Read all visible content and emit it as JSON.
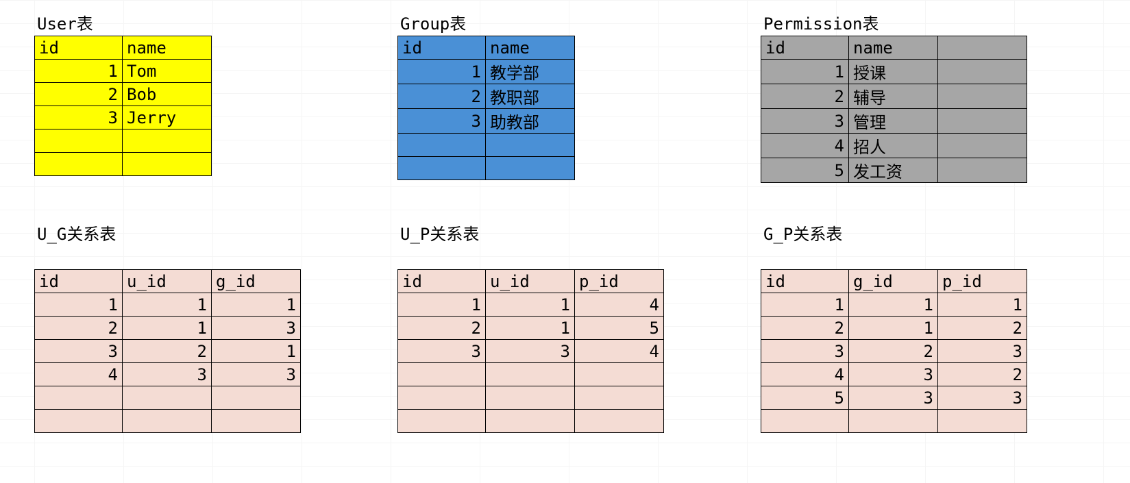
{
  "user": {
    "title": "User表",
    "headers": [
      "id",
      "name"
    ],
    "rows": [
      {
        "id": "1",
        "name": "Tom"
      },
      {
        "id": "2",
        "name": "Bob"
      },
      {
        "id": "3",
        "name": "Jerry"
      }
    ]
  },
  "group": {
    "title": "Group表",
    "headers": [
      "id",
      "name"
    ],
    "rows": [
      {
        "id": "1",
        "name": "教学部"
      },
      {
        "id": "2",
        "name": "教职部"
      },
      {
        "id": "3",
        "name": "助教部"
      }
    ]
  },
  "permission": {
    "title": "Permission表",
    "headers": [
      "id",
      "name"
    ],
    "rows": [
      {
        "id": "1",
        "name": "授课"
      },
      {
        "id": "2",
        "name": "辅导"
      },
      {
        "id": "3",
        "name": "管理"
      },
      {
        "id": "4",
        "name": "招人"
      },
      {
        "id": "5",
        "name": "发工资"
      }
    ]
  },
  "ug": {
    "title": "U_G关系表",
    "headers": [
      "id",
      "u_id",
      "g_id"
    ],
    "rows": [
      {
        "id": "1",
        "u_id": "1",
        "g_id": "1"
      },
      {
        "id": "2",
        "u_id": "1",
        "g_id": "3"
      },
      {
        "id": "3",
        "u_id": "2",
        "g_id": "1"
      },
      {
        "id": "4",
        "u_id": "3",
        "g_id": "3"
      }
    ]
  },
  "up": {
    "title": "U_P关系表",
    "headers": [
      "id",
      "u_id",
      "p_id"
    ],
    "rows": [
      {
        "id": "1",
        "u_id": "1",
        "p_id": "4"
      },
      {
        "id": "2",
        "u_id": "1",
        "p_id": "5"
      },
      {
        "id": "3",
        "u_id": "3",
        "p_id": "4"
      }
    ]
  },
  "gp": {
    "title": "G_P关系表",
    "headers": [
      "id",
      "g_id",
      "p_id"
    ],
    "rows": [
      {
        "id": "1",
        "g_id": "1",
        "p_id": "1"
      },
      {
        "id": "2",
        "g_id": "1",
        "p_id": "2"
      },
      {
        "id": "3",
        "g_id": "2",
        "p_id": "3"
      },
      {
        "id": "4",
        "g_id": "3",
        "p_id": "2"
      },
      {
        "id": "5",
        "g_id": "3",
        "p_id": "3"
      }
    ]
  }
}
